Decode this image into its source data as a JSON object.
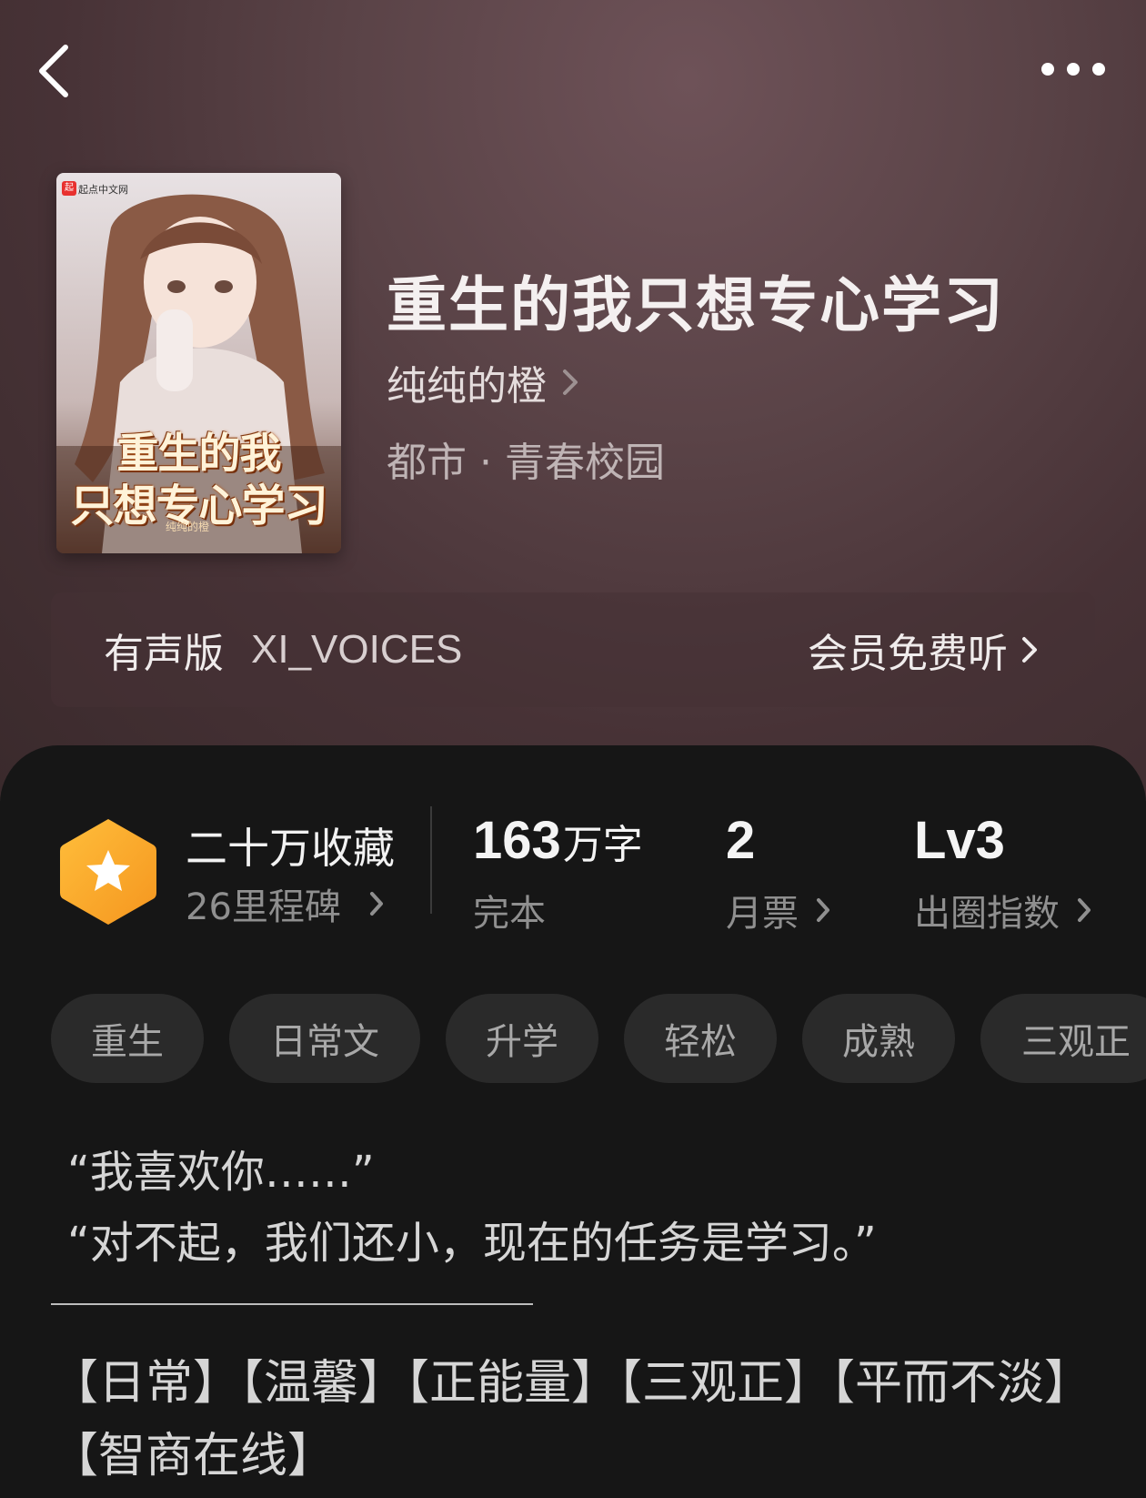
{
  "header": {
    "back_icon": "chevron-left-icon",
    "more_icon": "more-dots-icon"
  },
  "book": {
    "cover": {
      "publisher": "起点中文网",
      "title_line1": "重生的我",
      "title_line2": "只想专心学习",
      "author": "纯纯的橙"
    },
    "title": "重生的我只想专心学习",
    "author": "纯纯的橙",
    "genre": "都市 · 青春校园"
  },
  "audio": {
    "label": "有声版",
    "voice": "XI_VOICES",
    "action": "会员免费听"
  },
  "stats": {
    "favorites": "二十万收藏",
    "milestones": "26里程碑",
    "word_count": "163",
    "word_unit": "万字",
    "status": "完本",
    "monthly_votes": "2",
    "monthly_votes_label": "月票",
    "level": "Lv3",
    "level_label": "出圈指数"
  },
  "tags": [
    "重生",
    "日常文",
    "升学",
    "轻松",
    "成熟",
    "三观正"
  ],
  "intro": {
    "quote1": "“我喜欢你……”",
    "quote2": "“对不起，我们还小，现在的任务是学习。”",
    "keywords": "【日常】【温馨】【正能量】【三观正】【平而不淡】【智商在线】"
  },
  "colors": {
    "header_bg": "#5a4347",
    "sheet_bg": "#161616",
    "badge_orange": "#f5a623",
    "tag_bg": "#2a2a2a"
  }
}
